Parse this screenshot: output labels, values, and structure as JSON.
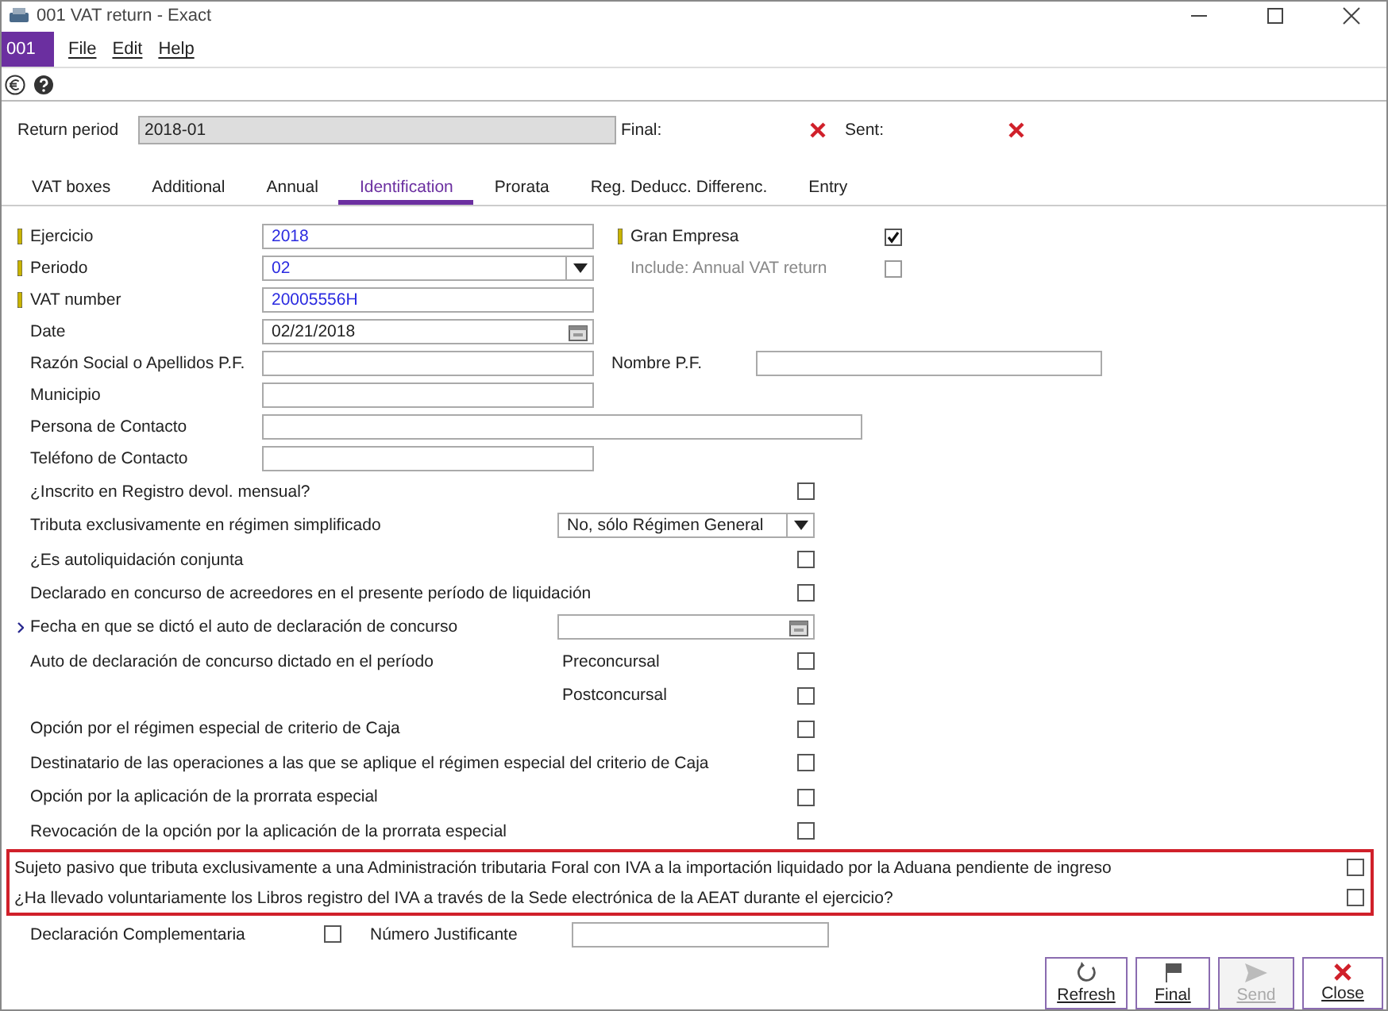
{
  "window": {
    "title": "001 VAT return - Exact"
  },
  "menu": {
    "badge": "001",
    "items": [
      "File",
      "Edit",
      "Help"
    ]
  },
  "header": {
    "period_label": "Return period",
    "period_value": "2018-01",
    "flags": [
      {
        "label": "Final:",
        "checked": false
      },
      {
        "label": "Sent:",
        "checked": false
      }
    ]
  },
  "tabs": [
    {
      "label": "VAT boxes",
      "selected": false
    },
    {
      "label": "Additional",
      "selected": false
    },
    {
      "label": "Annual",
      "selected": false
    },
    {
      "label": "Identification",
      "selected": true
    },
    {
      "label": "Prorata",
      "selected": false
    },
    {
      "label": "Reg. Deducc. Differenc.",
      "selected": false
    },
    {
      "label": "Entry",
      "selected": false
    }
  ],
  "fields": [
    {
      "label": "Ejercicio",
      "required": true,
      "kind": "text",
      "value": "2018",
      "side": {
        "kind": "check",
        "label": "Gran Empresa",
        "required": true,
        "disabled": false,
        "checked": true
      }
    },
    {
      "label": "Periodo",
      "required": true,
      "kind": "dropdown",
      "value": "02",
      "side": {
        "kind": "check",
        "label": "Include: Annual VAT return",
        "required": false,
        "disabled": true,
        "checked": false
      }
    },
    {
      "label": "VAT number",
      "required": true,
      "kind": "text",
      "value": "20005556H"
    },
    {
      "label": "Date",
      "required": false,
      "kind": "date",
      "value": "02/21/2018"
    },
    {
      "label": "Razón Social o Apellidos P.F.",
      "required": false,
      "kind": "text",
      "side": {
        "kind": "text",
        "label": "Nombre P.F."
      }
    },
    {
      "label": "Municipio",
      "required": false,
      "kind": "text"
    },
    {
      "label": "Persona de Contacto",
      "required": false,
      "kind": "wide"
    },
    {
      "label": "Teléfono de Contacto",
      "required": false,
      "kind": "text"
    }
  ],
  "options": [
    {
      "kind": "check",
      "label": "¿Inscrito en Registro devol. mensual?",
      "checked": false
    },
    {
      "kind": "dropdown",
      "label": "Tributa exclusivamente en régimen simplificado",
      "value": "No, sólo Régimen General"
    },
    {
      "kind": "check",
      "label": "¿Es autoliquidación conjunta",
      "checked": false
    },
    {
      "kind": "check",
      "label": "Declarado en concurso de acreedores en el presente período de liquidación",
      "checked": false
    },
    {
      "kind": "date",
      "label": "Fecha en que se dictó el auto de declaración de concurso",
      "current": true
    },
    {
      "kind": "sub_check",
      "label": "Auto de declaración de concurso dictado en el período",
      "sublabel": "Preconcursal",
      "checked": false
    },
    {
      "kind": "sub_check",
      "sublabel": "Postconcursal",
      "checked": false
    },
    {
      "kind": "check",
      "label": "Opción por el régimen especial de criterio de Caja",
      "checked": false
    },
    {
      "kind": "check",
      "label": "Destinatario de las operaciones a las que se aplique el régimen especial del criterio de Caja",
      "checked": false
    },
    {
      "kind": "check",
      "label": "Opción por la aplicación de la prorrata especial",
      "checked": false
    },
    {
      "kind": "check",
      "label": "Revocación de la opción por la aplicación de la prorrata especial",
      "checked": false
    }
  ],
  "highlighted": [
    {
      "label": "Sujeto pasivo que tributa exclusivamente a una Administración tributaria Foral con IVA a la importación liquidado por la Aduana pendiente de ingreso",
      "checked": false
    },
    {
      "label": "¿Ha llevado voluntariamente los Libros registro del IVA a través de la Sede electrónica de la AEAT durante el ejercicio?",
      "checked": false
    }
  ],
  "footer": {
    "check_label": "Declaración Complementaria",
    "checked": false,
    "field_label": "Número Justificante"
  },
  "buttons": [
    {
      "kind": "refresh",
      "label": "Refresh",
      "disabled": false
    },
    {
      "kind": "final",
      "label": "Final",
      "disabled": false
    },
    {
      "kind": "send",
      "label": "Send",
      "disabled": true
    },
    {
      "kind": "close",
      "label": "Close",
      "disabled": false
    }
  ]
}
